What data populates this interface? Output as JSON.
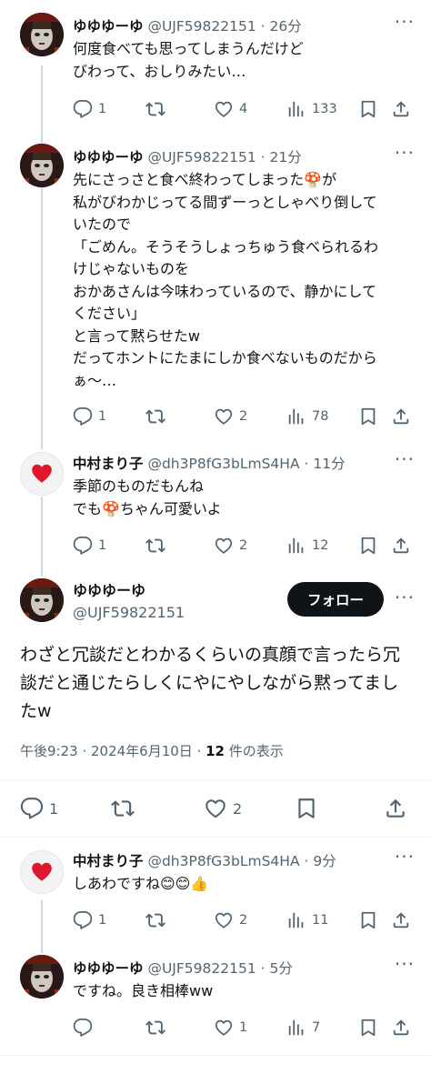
{
  "accent": "#0f1419",
  "meta_color": "#536471",
  "replies_above": [
    {
      "name": "ゆゆゆーゆ",
      "handle": "@UJF59822151",
      "time": "26分",
      "text": "何度食べても思ってしまうんだけど\nびわって、おしりみたい…",
      "stats": {
        "reply": "1",
        "retweet": "",
        "like": "4",
        "views": "133"
      }
    },
    {
      "name": "ゆゆゆーゆ",
      "handle": "@UJF59822151",
      "time": "21分",
      "text": "先にさっさと食べ終わってしまった🍄が\n私がびわかじってる間ずーっとしゃべり倒して\nいたので\n「ごめん。そうそうしょっちゅう食べられるわ\nけじゃないものを\nおかあさんは今味わっているので、静かにして\nください」\nと言って黙らせたw\nだってホントにたまにしか食べないものだから\nぁ〜…",
      "stats": {
        "reply": "1",
        "retweet": "",
        "like": "2",
        "views": "78"
      }
    },
    {
      "name": "中村まり子",
      "handle": "@dh3P8fG3bLmS4HA",
      "time": "11分",
      "text": "季節のものだもんね\nでも🍄ちゃん可愛いよ",
      "stats": {
        "reply": "1",
        "retweet": "",
        "like": "2",
        "views": "12"
      }
    }
  ],
  "main_tweet": {
    "name": "ゆゆゆーゆ",
    "handle": "@UJF59822151",
    "follow_label": "フォロー",
    "text": "わざと冗談だとわかるくらいの真顔で言ったら冗談だと通じたらしくにやにやしながら黙ってましたw",
    "timestamp": "午後9:23 · 2024年6月10日 · ",
    "views_count": "12",
    "views_label": " 件の表示",
    "stats": {
      "reply": "1",
      "retweet": "",
      "like": "2"
    }
  },
  "replies_below": [
    {
      "name": "中村まり子",
      "handle": "@dh3P8fG3bLmS4HA",
      "time": "9分",
      "text": "しあわですね😊😊👍",
      "stats": {
        "reply": "1",
        "retweet": "",
        "like": "2",
        "views": "11"
      }
    },
    {
      "name": "ゆゆゆーゆ",
      "handle": "@UJF59822151",
      "time": "5分",
      "text": "ですね。良き相棒ww",
      "stats": {
        "reply": "",
        "retweet": "",
        "like": "1",
        "views": "7"
      }
    }
  ],
  "icons": [
    "reply-icon",
    "retweet-icon",
    "like-icon",
    "views-icon",
    "bookmark-icon",
    "share-icon",
    "more-icon",
    "heart-avatar-icon"
  ]
}
